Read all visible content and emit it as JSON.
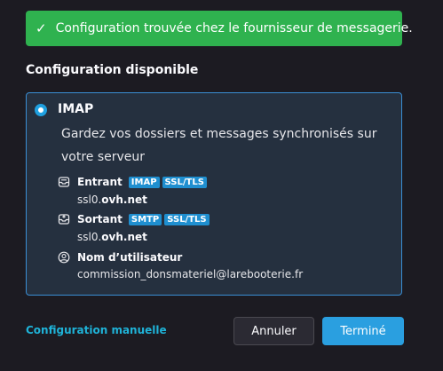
{
  "notice": {
    "text": "Configuration trouvée chez le fournisseur de messagerie.",
    "icon": "check-icon",
    "color": "#2fb24f"
  },
  "section_title": "Configuration disponible",
  "option": {
    "protocol": "IMAP",
    "description": "Gardez vos dossiers et messages synchronisés sur votre serveur",
    "selected": true,
    "incoming": {
      "label": "Entrant",
      "badges": [
        "IMAP",
        "SSL/TLS"
      ],
      "host_prefix": "ssl0.",
      "host_domain": "ovh.net"
    },
    "outgoing": {
      "label": "Sortant",
      "badges": [
        "SMTP",
        "SSL/TLS"
      ],
      "host_prefix": "ssl0.",
      "host_domain": "ovh.net"
    },
    "username": {
      "label": "Nom d’utilisateur",
      "value": "commission_donsmateriel@larebooterie.fr"
    }
  },
  "footer": {
    "manual_link": "Configuration manuelle",
    "cancel_label": "Annuler",
    "done_label": "Terminé"
  },
  "colors": {
    "accent": "#2a9fe0",
    "link": "#1fb3d8",
    "badge": "#1f8fd0"
  }
}
